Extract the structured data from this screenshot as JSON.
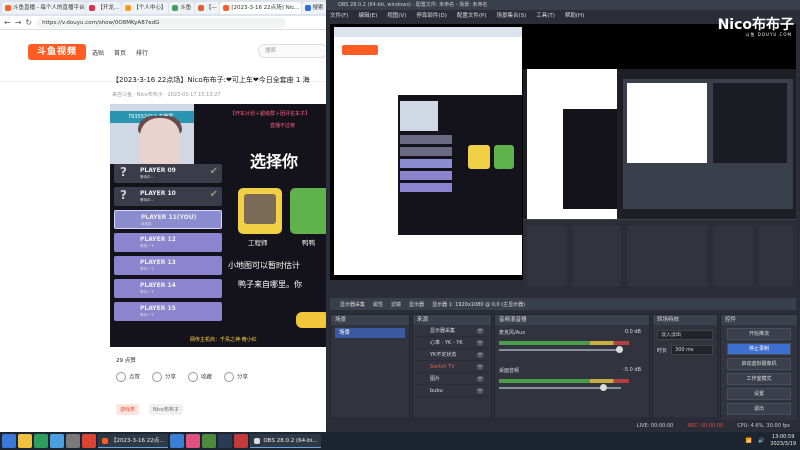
{
  "browser": {
    "tabs": [
      "斗鱼直播 - 每个人的直播平台",
      "【开龙...",
      "【个人中心】",
      "斗鱼",
      "【—",
      "[2023-3-16 22点场] Nic...",
      "搜索"
    ],
    "url": "https://v.douyu.com/show/0O8MKyA87edG",
    "nav": {
      "back": "←",
      "forward": "→",
      "reload": "↻"
    }
  },
  "site": {
    "logo": "斗鱼视频",
    "nav": [
      "选贴",
      "首页",
      "排行"
    ],
    "search_placeholder": "搜索"
  },
  "post": {
    "title": "【2023-3-16 22点场】Nico布布子:❤可上车❤今日全套座 1 海",
    "meta": "来自斗鱼 · Nico布布子 · 2023-03-17 15:13:27",
    "likes": "29",
    "likes_label": "点赞",
    "actions": [
      "点赞",
      "分享",
      "收藏",
      "分享"
    ],
    "tags": [
      "游戏类",
      "Nico布布子"
    ]
  },
  "video": {
    "top_banner": "【开车计划＋超级群＋团评名车子】",
    "top_banner2": "直播不过夜",
    "cam_label": "793552412 主播屏",
    "title": "选择你",
    "players": [
      {
        "name": "PLAYER 09",
        "sub": "等待中...",
        "state": "dark"
      },
      {
        "name": "PLAYER 10",
        "sub": "等待中...",
        "state": "dark"
      },
      {
        "name": "PLAYER 11(YOU)",
        "sub": "请选择",
        "state": "sel"
      },
      {
        "name": "PLAYER 12",
        "sub": "等待一下",
        "state": "purple"
      },
      {
        "name": "PLAYER 13",
        "sub": "等待一下",
        "state": "purple"
      },
      {
        "name": "PLAYER 14",
        "sub": "等待一下",
        "state": "purple"
      },
      {
        "name": "PLAYER 15",
        "sub": "等待一下",
        "state": "purple"
      }
    ],
    "role_engineer": "工程师",
    "role_duck": "鸭鸭",
    "tip1": "小地图可以暂时估计",
    "tip2": "鸭子来自哪里。你",
    "danmu": "网传主机商：千鳥之神·俺小红"
  },
  "obs": {
    "title": "OBS 28.0.2 (64-bit, windows) - 配置文件: 未命名 - 场景: 未命名",
    "menu": [
      "文件(F)",
      "编辑(E)",
      "视图(V)",
      "停靠部件(D)",
      "配置文件(P)",
      "场景集合(S)",
      "工具(T)",
      "帮助(H)"
    ],
    "watermark": "Nico布布子",
    "watermark_brand": "斗鱼 DOUYU.COM",
    "controls_bar": [
      "显示器采集",
      "属性",
      "滤镜",
      "显示器",
      "显示器 1: 1920x1080 @ 0,0 (主显示器)"
    ],
    "docks": {
      "scenes": {
        "title": "场景",
        "items": [
          "场景"
        ]
      },
      "sources": {
        "title": "来源",
        "items": [
          "显示器采集",
          "心率 - YK - YK",
          "YK不定状态",
          "Switch TV",
          "图片",
          "bubu"
        ]
      },
      "mixer": {
        "title": "音频混音器",
        "channels": [
          {
            "name": "麦克风/Aux",
            "db": "0.0 dB"
          },
          {
            "name": "桌面音频",
            "db": "-5.0 dB"
          }
        ]
      },
      "transitions": {
        "title": "转场特效",
        "type": "淡入淡出",
        "duration_label": "时长",
        "duration": "300 ms"
      },
      "controls": {
        "title": "控件",
        "buttons": [
          "开始推流",
          "停止录制",
          "启动虚拟摄像机",
          "工作室模式",
          "设置",
          "退出"
        ]
      }
    },
    "status": {
      "live": "LIVE: 00:00:00",
      "rec": "REC: 00:00:00",
      "cpu": "CPU: 4.6%, 30.00 fps"
    }
  },
  "taskbar": {
    "apps": [
      "【2023-3-16 22点...",
      "OBS 28.0.2 (64-bi..."
    ],
    "time": "13:00:59",
    "date": "2023/3/19"
  },
  "colors": {
    "accent": "#ff5d23",
    "obs_bg": "#2b2e38",
    "obs_active": "#3d6fd0"
  }
}
